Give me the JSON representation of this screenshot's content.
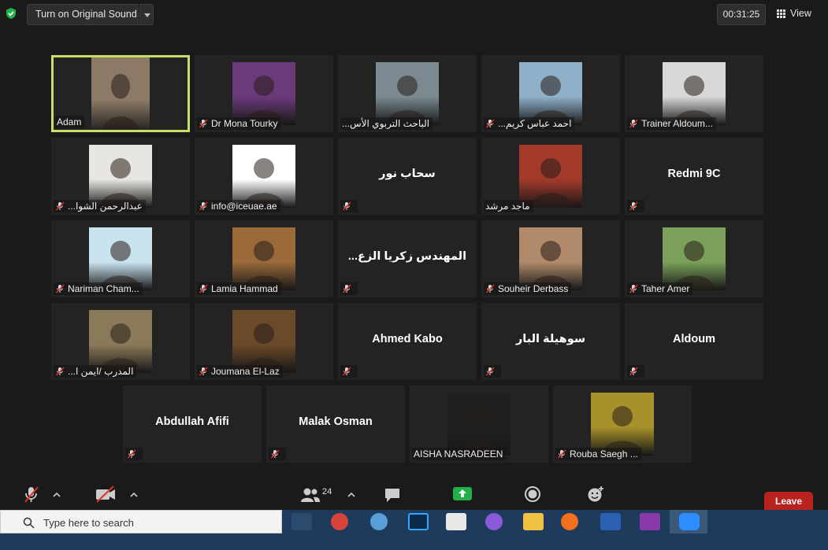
{
  "topbar": {
    "sound_button": "Turn on Original Sound",
    "timer": "00:31:25",
    "view_label": "View"
  },
  "participants": [
    {
      "name": "Adam",
      "kind": "photo",
      "active": true,
      "muted": false,
      "bg": "#8c7a66"
    },
    {
      "name": "Dr Mona Tourky",
      "kind": "photo",
      "muted": true,
      "bg": "#6b3a7a"
    },
    {
      "name": "...الباحث التربوي الأس",
      "kind": "photo",
      "muted": false,
      "bg": "#7a8a90"
    },
    {
      "name": "...احمد عباس كريم",
      "kind": "photo",
      "muted": true,
      "bg": "#8fb0c8"
    },
    {
      "name": "Trainer Aldoum...",
      "kind": "photo",
      "muted": true,
      "bg": "#d8d8d8"
    },
    {
      "name": "...عبدالرحمن الشوا",
      "kind": "photo",
      "muted": true,
      "bg": "#e8e6e0"
    },
    {
      "name": "info@iceuae.ae",
      "kind": "photo",
      "muted": true,
      "bg": "#ffffff"
    },
    {
      "name": "سحاب نور",
      "kind": "text",
      "muted": true
    },
    {
      "name": "ماجد مرشد",
      "kind": "photo",
      "muted": false,
      "bg": "#a33a2a"
    },
    {
      "name": "Redmi 9C",
      "kind": "text",
      "muted": true
    },
    {
      "name": "Nariman Cham...",
      "kind": "photo",
      "muted": true,
      "bg": "#c9e3ef"
    },
    {
      "name": "Lamia Hammad",
      "kind": "photo",
      "muted": true,
      "bg": "#9a6a3a"
    },
    {
      "name": "...المهندس زكريا الزع",
      "kind": "text",
      "muted": true
    },
    {
      "name": "Souheir Derbass",
      "kind": "photo",
      "muted": true,
      "bg": "#b08a6a"
    },
    {
      "name": "Taher Amer",
      "kind": "photo",
      "muted": true,
      "bg": "#7aa05a"
    },
    {
      "name": "...المدرب /ايمن ا",
      "kind": "photo",
      "muted": true,
      "bg": "#8a7a5a"
    },
    {
      "name": "Joumana El-Laz",
      "kind": "photo",
      "muted": true,
      "bg": "#6a4a2a"
    },
    {
      "name": "Ahmed Kabo",
      "kind": "text",
      "muted": true
    },
    {
      "name": "سوهيلة البار",
      "kind": "text",
      "muted": true
    },
    {
      "name": "Aldoum",
      "kind": "text",
      "muted": true
    },
    {
      "name": "Abdullah Afifi",
      "kind": "text",
      "muted": true
    },
    {
      "name": "Malak Osman",
      "kind": "text",
      "muted": true
    },
    {
      "name": "AISHA NASRADEEN",
      "kind": "photo",
      "muted": false,
      "bg": "#202020"
    },
    {
      "name": "Rouba Saegh ...",
      "kind": "photo",
      "muted": true,
      "bg": "#a8902a"
    }
  ],
  "toolbar": {
    "participant_count": "24",
    "leave_label": "Leave"
  },
  "taskbar": {
    "search_placeholder": "Type here to search"
  },
  "colors": {
    "active_border": "#c8e06a",
    "leave": "#b8231f",
    "share_green": "#22b04a",
    "muted_red": "#e0312b"
  }
}
